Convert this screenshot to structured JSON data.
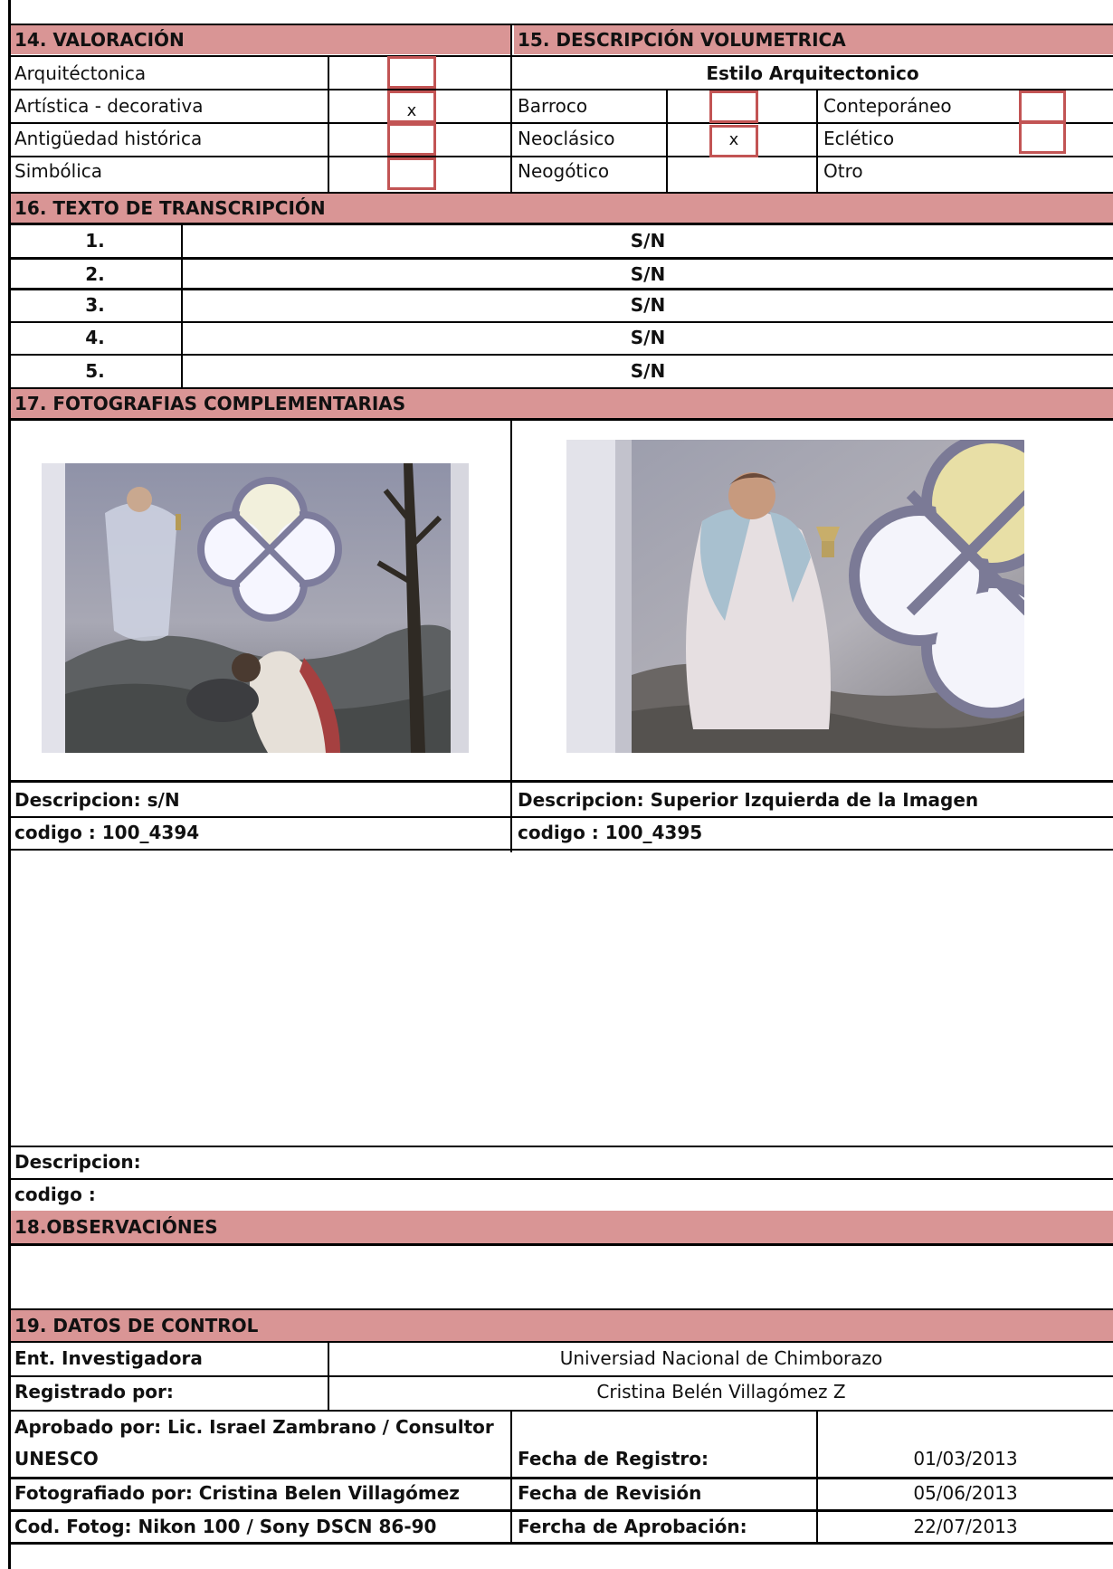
{
  "valoracion": {
    "header": "14. VALORACIÓN",
    "items": [
      {
        "label": "Arquitéctonica",
        "mark": ""
      },
      {
        "label": "Artística - decorativa",
        "mark": "x"
      },
      {
        "label": "Antigüedad histórica",
        "mark": ""
      },
      {
        "label": "Simbólica",
        "mark": ""
      }
    ]
  },
  "volumetrica": {
    "header": "15. DESCRIPCIÓN VOLUMETRICA",
    "subheader": "Estilo Arquitectonico",
    "styles": [
      {
        "label": "Barroco",
        "mark": ""
      },
      {
        "label": "Conteporáneo",
        "mark": ""
      },
      {
        "label": "Neoclásico",
        "mark": "x"
      },
      {
        "label": "Eclético",
        "mark": ""
      },
      {
        "label": "Neogótico",
        "mark": ""
      },
      {
        "label": "Otro",
        "mark": ""
      }
    ]
  },
  "transcripcion": {
    "header": "16. TEXTO DE TRANSCRIPCIÓN",
    "rows": [
      {
        "num": "1.",
        "text": "S/N"
      },
      {
        "num": "2.",
        "text": "S/N"
      },
      {
        "num": "3.",
        "text": "S/N"
      },
      {
        "num": "4.",
        "text": "S/N"
      },
      {
        "num": "5.",
        "text": "S/N"
      }
    ]
  },
  "fotografias": {
    "header": "17. FOTOGRAFIAS COMPLEMENTARIAS",
    "photos": [
      {
        "descripcion": "Descripcion: s/N",
        "codigo": "codigo : 100_4394"
      },
      {
        "descripcion": "Descripcion: Superior Izquierda de la Imagen",
        "codigo": "codigo :  100_4395"
      }
    ],
    "extra": {
      "descripcion": "Descripcion:",
      "codigo": "codigo :"
    }
  },
  "observaciones": {
    "header": "18.OBSERVACIÓNES"
  },
  "control": {
    "header": "19. DATOS DE CONTROL",
    "ent_label": "Ent. Investigadora",
    "ent_value": "Universiad Nacional de Chimborazo",
    "registrado_label": "Registrado por:",
    "registrado_value": "Cristina Belén Villagómez Z",
    "aprobado_line1": "Aprobado por: Lic. Israel Zambrano / Consultor",
    "aprobado_line2": "UNESCO",
    "fotografiado": "Fotografiado por:  Cristina Belen Villagómez",
    "cod_fotog": "Cod. Fotog: Nikon 100 / Sony DSCN 86-90",
    "fecha_registro_label": "Fecha de Registro:",
    "fecha_registro": "01/03/2013",
    "fecha_revision_label": "Fecha de Revisión",
    "fecha_revision": "05/06/2013",
    "fecha_aprobacion_label": "Fercha de Aprobación:",
    "fecha_aprobacion": "22/07/2013"
  },
  "colors": {
    "header_bg": "#d99595",
    "checkbox_border": "#c25454"
  }
}
